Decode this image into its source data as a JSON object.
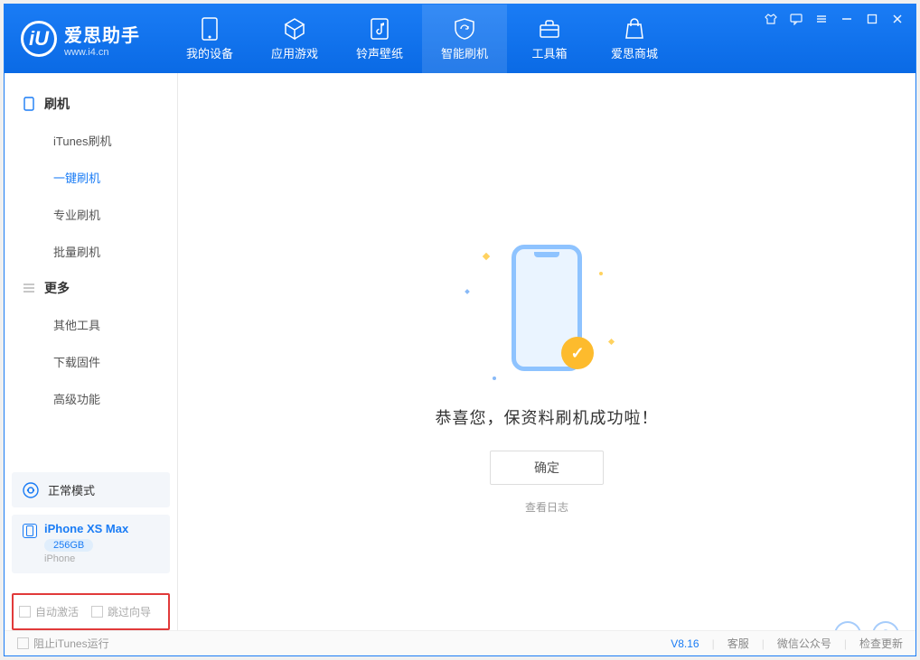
{
  "logo": {
    "cn": "爱思助手",
    "en": "www.i4.cn",
    "mark": "iU"
  },
  "nav": [
    {
      "label": "我的设备"
    },
    {
      "label": "应用游戏"
    },
    {
      "label": "铃声壁纸"
    },
    {
      "label": "智能刷机"
    },
    {
      "label": "工具箱"
    },
    {
      "label": "爱思商城"
    }
  ],
  "sidebar": {
    "group1_title": "刷机",
    "items1": [
      {
        "label": "iTunes刷机"
      },
      {
        "label": "一键刷机"
      },
      {
        "label": "专业刷机"
      },
      {
        "label": "批量刷机"
      }
    ],
    "group2_title": "更多",
    "items2": [
      {
        "label": "其他工具"
      },
      {
        "label": "下载固件"
      },
      {
        "label": "高级功能"
      }
    ],
    "mode_card": "正常模式",
    "device": {
      "name": "iPhone XS Max",
      "storage": "256GB",
      "type": "iPhone"
    },
    "flags": {
      "auto_activate": "自动激活",
      "skip_guide": "跳过向导"
    }
  },
  "main": {
    "success_msg": "恭喜您，保资料刷机成功啦！",
    "ok_button": "确定",
    "view_log": "查看日志"
  },
  "footer": {
    "block_itunes": "阻止iTunes运行",
    "version": "V8.16",
    "support": "客服",
    "wechat": "微信公众号",
    "update": "检查更新"
  }
}
